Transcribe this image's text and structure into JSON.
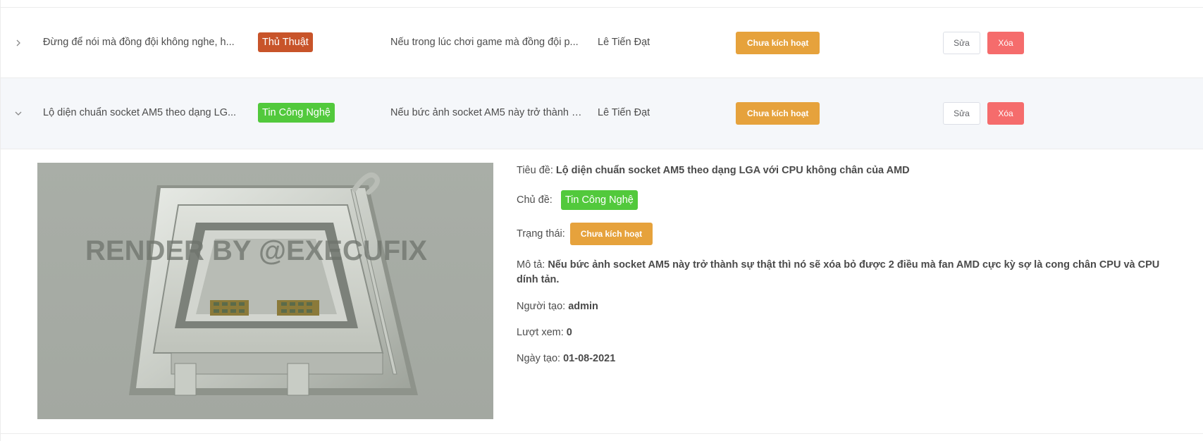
{
  "rows": [
    {
      "expand_icon": "chevron-right-icon",
      "title": "Đừng để nói mà đồng đội không nghe, h...",
      "category": "Thủ Thuật",
      "description": "Nếu trong lúc chơi game mà đồng đội p...",
      "author": "Lê Tiến Đạt",
      "status": "Chưa kích hoạt",
      "edit_label": "Sửa",
      "delete_label": "Xóa"
    },
    {
      "expand_icon": "chevron-down-icon",
      "title": "Lộ diện chuẩn socket AM5 theo dạng LG...",
      "category": "Tin Công Nghệ",
      "description": "Nếu bức ảnh socket AM5 này trở thành s...",
      "author": "Lê Tiến Đạt",
      "status": "Chưa kích hoạt",
      "edit_label": "Sửa",
      "delete_label": "Xóa"
    }
  ],
  "detail": {
    "image_watermark": "RENDER BY @EXECUFIX",
    "title_label": "Tiêu đề:",
    "title_value": "Lộ diện chuẩn socket AM5 theo dạng LGA với CPU không chân của AMD",
    "topic_label": "Chủ đề:",
    "topic_value": "Tin Công Nghệ",
    "status_label": "Trạng thái:",
    "status_value": "Chưa kích hoạt",
    "desc_label": "Mô tả:",
    "desc_value": "Nếu bức ảnh socket AM5 này trở thành sự thật thì nó sẽ xóa bỏ được 2 điều mà fan AMD cực kỳ sợ là cong chân CPU và CPU dính tản.",
    "creator_label": "Người tạo:",
    "creator_value": "admin",
    "views_label": "Lượt xem:",
    "views_value": "0",
    "date_label": "Ngày tạo:",
    "date_value": "01-08-2021"
  },
  "colors": {
    "status_orange": "#e6a23c",
    "delete_red": "#f56c6c",
    "tag_green": "#52c93c",
    "tag_rust": "#c8542a"
  }
}
